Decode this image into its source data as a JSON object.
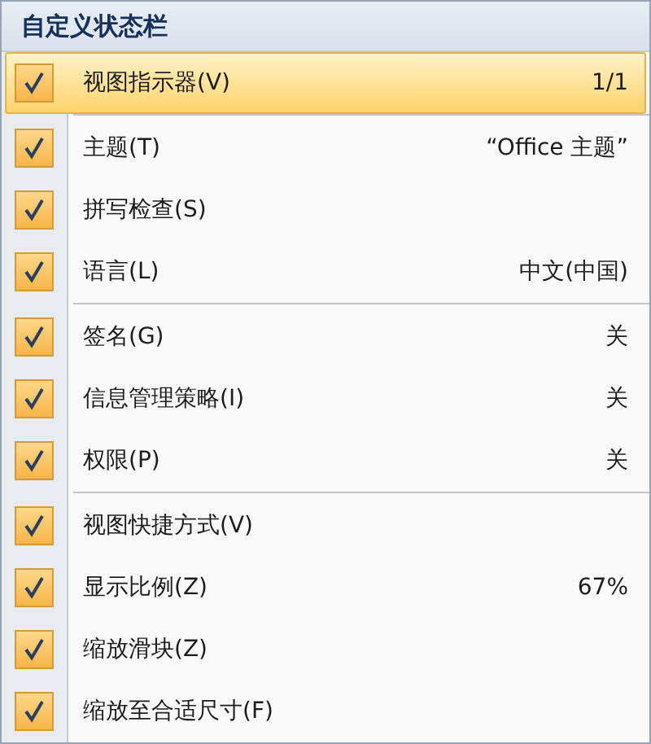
{
  "menu": {
    "title": "自定义状态栏",
    "groups": [
      {
        "items": [
          {
            "label": "视图指示器(V)",
            "value": "1/1",
            "checked": true,
            "selected": true
          }
        ]
      },
      {
        "items": [
          {
            "label": "主题(T)",
            "value": "“Office 主题”",
            "checked": true,
            "selected": false
          },
          {
            "label": "拼写检查(S)",
            "checked": true,
            "selected": false
          },
          {
            "label": "语言(L)",
            "value": "中文(中国)",
            "checked": true,
            "selected": false
          }
        ]
      },
      {
        "items": [
          {
            "label": "签名(G)",
            "value": "关",
            "checked": true,
            "selected": false
          },
          {
            "label": "信息管理策略(I)",
            "value": "关",
            "checked": true,
            "selected": false
          },
          {
            "label": "权限(P)",
            "value": "关",
            "checked": true,
            "selected": false
          }
        ]
      },
      {
        "items": [
          {
            "label": "视图快捷方式(V)",
            "checked": true,
            "selected": false
          },
          {
            "label": "显示比例(Z)",
            "value": "67%",
            "checked": true,
            "selected": false
          },
          {
            "label": "缩放滑块(Z)",
            "checked": true,
            "selected": false
          },
          {
            "label": "缩放至合适尺寸(F)",
            "checked": true,
            "selected": false
          }
        ]
      }
    ]
  }
}
